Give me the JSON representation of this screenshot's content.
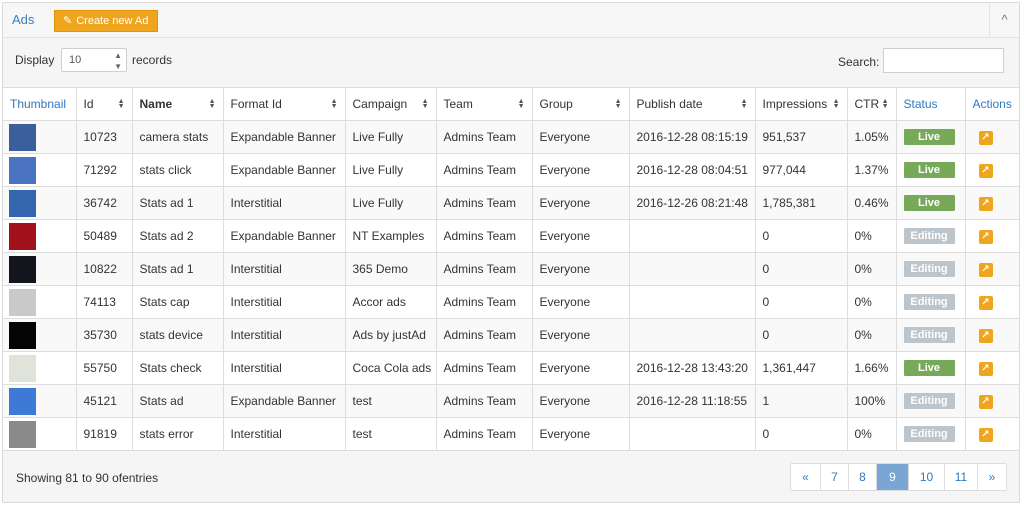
{
  "header": {
    "title": "Ads",
    "create_button": "Create new Ad",
    "collapse_glyph": "^"
  },
  "controls": {
    "display_label": "Display",
    "display_value": "10",
    "records_label": "records",
    "search_label": "Search:",
    "search_value": ""
  },
  "table": {
    "columns": [
      "Thumbnail",
      "Id",
      "Name",
      "Format Id",
      "Campaign",
      "Team",
      "Group",
      "Publish date",
      "Impressions",
      "CTR",
      "Status",
      "Actions"
    ],
    "rows": [
      {
        "thumb": "#3b5f9c",
        "id": "10723",
        "name": "camera stats",
        "format": "Expandable Banner",
        "campaign": "Live Fully",
        "team": "Admins Team",
        "group": "Everyone",
        "publish": "2016-12-28 08:15:19",
        "impressions": "951,537",
        "ctr": "1.05%",
        "status": "Live",
        "status_type": "live"
      },
      {
        "thumb": "#4a74c2",
        "id": "71292",
        "name": "stats click",
        "format": "Expandable Banner",
        "campaign": "Live Fully",
        "team": "Admins Team",
        "group": "Everyone",
        "publish": "2016-12-28 08:04:51",
        "impressions": "977,044",
        "ctr": "1.37%",
        "status": "Live",
        "status_type": "live"
      },
      {
        "thumb": "#3466ad",
        "id": "36742",
        "name": "Stats ad 1",
        "format": "Interstitial",
        "campaign": "Live Fully",
        "team": "Admins Team",
        "group": "Everyone",
        "publish": "2016-12-26 08:21:48",
        "impressions": "1,785,381",
        "ctr": "0.46%",
        "status": "Live",
        "status_type": "live"
      },
      {
        "thumb": "#a1121c",
        "id": "50489",
        "name": "Stats ad 2",
        "format": "Expandable Banner",
        "campaign": "NT Examples",
        "team": "Admins Team",
        "group": "Everyone",
        "publish": "",
        "impressions": "0",
        "ctr": "0%",
        "status": "Editing",
        "status_type": "editing"
      },
      {
        "thumb": "#12151c",
        "id": "10822",
        "name": "Stats ad 1",
        "format": "Interstitial",
        "campaign": "365 Demo",
        "team": "Admins Team",
        "group": "Everyone",
        "publish": "",
        "impressions": "0",
        "ctr": "0%",
        "status": "Editing",
        "status_type": "editing"
      },
      {
        "thumb": "#c9c9c9",
        "id": "74113",
        "name": "Stats cap",
        "format": "Interstitial",
        "campaign": "Accor ads",
        "team": "Admins Team",
        "group": "Everyone",
        "publish": "",
        "impressions": "0",
        "ctr": "0%",
        "status": "Editing",
        "status_type": "editing"
      },
      {
        "thumb": "#050505",
        "id": "35730",
        "name": "stats device",
        "format": "Interstitial",
        "campaign": "Ads by justAd",
        "team": "Admins Team",
        "group": "Everyone",
        "publish": "",
        "impressions": "0",
        "ctr": "0%",
        "status": "Editing",
        "status_type": "editing"
      },
      {
        "thumb": "#dfe3d9",
        "id": "55750",
        "name": "Stats check",
        "format": "Interstitial",
        "campaign": "Coca Cola ads",
        "team": "Admins Team",
        "group": "Everyone",
        "publish": "2016-12-28 13:43:20",
        "impressions": "1,361,447",
        "ctr": "1.66%",
        "status": "Live",
        "status_type": "live"
      },
      {
        "thumb": "#3d7ad6",
        "id": "45121",
        "name": "Stats ad",
        "format": "Expandable Banner",
        "campaign": "test",
        "team": "Admins Team",
        "group": "Everyone",
        "publish": "2016-12-28 11:18:55",
        "impressions": "1",
        "ctr": "100%",
        "status": "Editing",
        "status_type": "editing"
      },
      {
        "thumb": "#8a8a8a",
        "id": "91819",
        "name": "stats error",
        "format": "Interstitial",
        "campaign": "test",
        "team": "Admins Team",
        "group": "Everyone",
        "publish": "",
        "impressions": "0",
        "ctr": "0%",
        "status": "Editing",
        "status_type": "editing"
      }
    ]
  },
  "footer": {
    "info": "Showing 81 to 90 ofentries",
    "pages": [
      "«",
      "7",
      "8",
      "9",
      "10",
      "11",
      "»"
    ],
    "active_page": "9"
  },
  "colors": {
    "accent": "#f0a51e",
    "link": "#2f79be",
    "live": "#78a95a",
    "editing": "#bcc4cc"
  },
  "icons": {
    "create": "pencil-icon",
    "action": "external-link-icon",
    "collapse": "chevron-up-icon",
    "sort": "sort-icon"
  }
}
